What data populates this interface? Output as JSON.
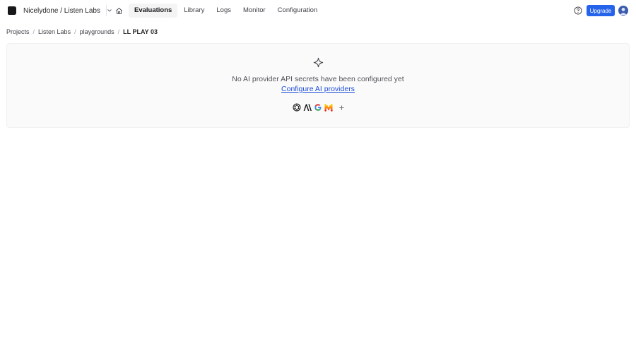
{
  "header": {
    "org_label": "Nicelydone / Listen Labs",
    "nav": [
      {
        "label": "Evaluations",
        "active": true
      },
      {
        "label": "Library",
        "active": false
      },
      {
        "label": "Logs",
        "active": false
      },
      {
        "label": "Monitor",
        "active": false
      },
      {
        "label": "Configuration",
        "active": false
      }
    ],
    "upgrade_label": "Upgrade"
  },
  "breadcrumb": {
    "items": [
      "Projects",
      "Listen Labs",
      "playgrounds"
    ],
    "current": "LL PLAY 03",
    "separator": "/"
  },
  "empty_state": {
    "message": "No AI provider API secrets have been configured yet",
    "link_label": "Configure AI providers"
  },
  "icons": {
    "logo": "logo-icon",
    "org_chevron": "chevron-down-icon",
    "home": "home-icon",
    "help": "help-circle-icon",
    "avatar": "user-avatar",
    "sparkle": "sparkle-icon",
    "providers": [
      "openai-icon",
      "anthropic-icon",
      "google-icon",
      "mistral-icon"
    ],
    "add": "plus-icon"
  },
  "colors": {
    "accent": "#2563eb",
    "link": "#1d4ed8",
    "panel_bg": "#fafafa",
    "nav_active_bg": "#f4f4f5"
  }
}
